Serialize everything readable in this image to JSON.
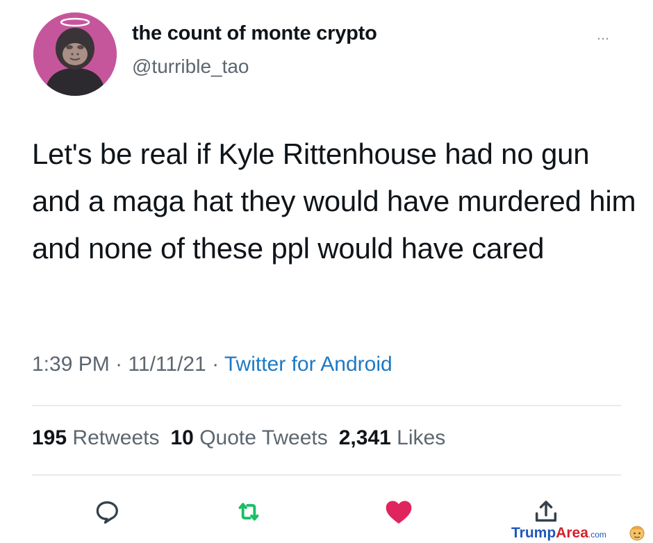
{
  "tweet": {
    "display_name": "the count of monte crypto",
    "handle": "@turrible_tao",
    "more_label": "...",
    "text": "Let's be real if Kyle Rittenhouse had no gun and a maga hat they would have murdered him and none of these ppl would have cared",
    "time": "1:39 PM",
    "date": "11/11/21",
    "separator": "·",
    "source": "Twitter for Android"
  },
  "stats": {
    "retweets_count": "195",
    "retweets_label": "Retweets",
    "quotes_count": "10",
    "quotes_label": "Quote Tweets",
    "likes_count": "2,341",
    "likes_label": "Likes"
  },
  "actions": {
    "reply_icon": "reply-icon",
    "retweet_icon": "retweet-icon",
    "like_icon": "heart-icon",
    "share_icon": "share-icon",
    "retweet_color": "#17bf63",
    "like_color": "#e0245e",
    "source_color": "#1d79c4"
  },
  "watermark": {
    "part1": "Trump",
    "part2": "Area",
    "part3": ".com"
  }
}
